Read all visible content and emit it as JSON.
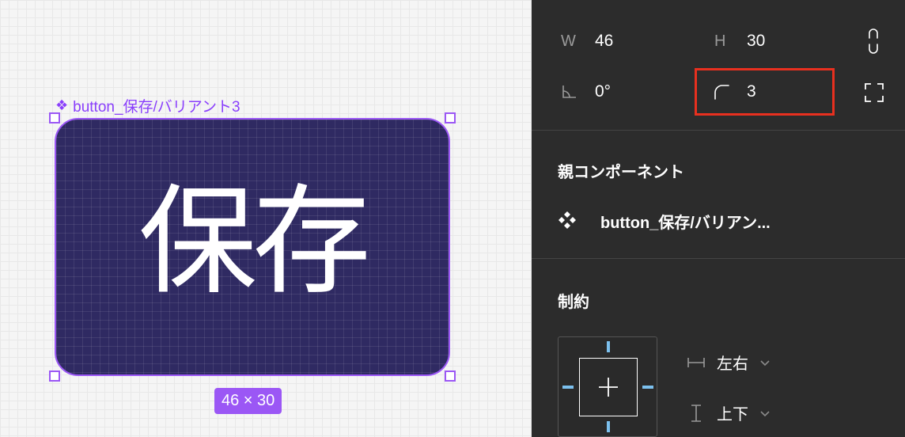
{
  "canvas": {
    "component_label": "button_保存/バリアント3",
    "button_text": "保存",
    "size_badge": "46 × 30"
  },
  "panel": {
    "width_label": "W",
    "width_value": "46",
    "height_label": "H",
    "height_value": "30",
    "rotation_value": "0°",
    "radius_value": "3",
    "parent_section_title": "親コンポーネント",
    "parent_component_name": "button_保存/バリアン...",
    "constraints_title": "制約",
    "horizontal_constraint": "左右",
    "vertical_constraint": "上下"
  },
  "colors": {
    "selection_purple": "#9b57f5",
    "button_fill": "#2f2a62",
    "highlight_red": "#e8301f",
    "constraint_blue": "#7cc0ee",
    "panel_bg": "#2c2c2c"
  }
}
